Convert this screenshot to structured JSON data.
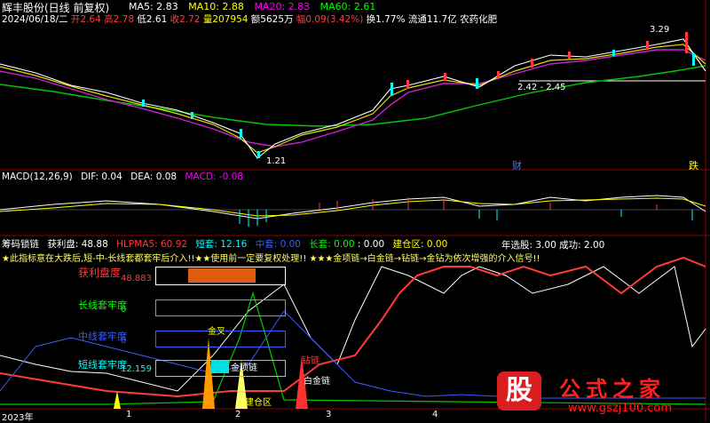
{
  "header": {
    "title": "辉丰股份(日线 前复权)",
    "ma_items": [
      {
        "label": "MA5: 2.83",
        "color": "#ffffff"
      },
      {
        "label": "MA10: 2.88",
        "color": "#ffff00"
      },
      {
        "label": "MA20: 2.83",
        "color": "#ff00ff"
      },
      {
        "label": "MA60: 2.61",
        "color": "#00ff00"
      }
    ],
    "info_date": "2024/06/18/二",
    "info_open": "开2.64",
    "info_high": "高2.78",
    "info_low": "低2.61",
    "info_close": "收2.72",
    "info_volume": "量207954",
    "info_amount": "额5625万",
    "info_change": "幅0.09(3.42%)",
    "info_turnover": "换1.77%",
    "info_float": "流通11.7亿",
    "info_sector": "农药化肥"
  },
  "price_chart": {
    "high_label": "3.29",
    "range_label": "2.42 - 2.45",
    "low_label": "1.21",
    "marker_cai": "财",
    "marker_die": "跌"
  },
  "macd": {
    "title": "MACD(12,26,9)",
    "dif": "DIF: 0.04",
    "dea": "DEA: 0.08",
    "macd": "MACD: -0.08"
  },
  "indicator": {
    "title": "筹码锁链",
    "items": [
      {
        "label": "获利盘: 48.88",
        "color": "#ffffff"
      },
      {
        "label": "HLPMA5: 60.92",
        "color": "#ff3b3b"
      },
      {
        "label": "短套: 12.16",
        "color": "#00ffff"
      },
      {
        "label": "中套: 0.00",
        "color": "#3a5bff"
      },
      {
        "label": "长套: 0.00",
        "color": "#00ff00"
      },
      {
        "label": ": 0.00",
        "color": "#ffffff"
      },
      {
        "label": "建仓区: 0.00",
        "color": "#ffff00"
      }
    ],
    "stats": "年选股: 3.00  成功: 2.00",
    "notice": "★此指标意在大跌后,短-中-长线套都套牢后介入!!★★使用前一定要复权处理!! ★★★金项链→白金链→钻链→金钻为依次增强的介入信号!!",
    "profit_label": "获利盘度",
    "profit_value": "48.883",
    "long_label": "长线套牢度",
    "long_value": "0",
    "mid_label": "中线套牢度",
    "mid_value": "0",
    "short_label": "短线套牢度",
    "short_value": "12.159",
    "signal_jincha": "金叉",
    "signal_jinxianglian": "金项链",
    "signal_jianqu": "建仓区",
    "signal_zuanlian": "钻链",
    "signal_baijinlian": "白金链"
  },
  "time_axis": {
    "year": "2023年",
    "ticks": [
      "1",
      "2",
      "3",
      "4"
    ]
  },
  "watermark": {
    "logo_char": "股",
    "brand": "公式之家",
    "url": "www.gszj100.com"
  },
  "colors": {
    "background": "#000000",
    "up": "#ff3b3b",
    "down": "#00ffff",
    "grid": "#8b0000"
  }
}
